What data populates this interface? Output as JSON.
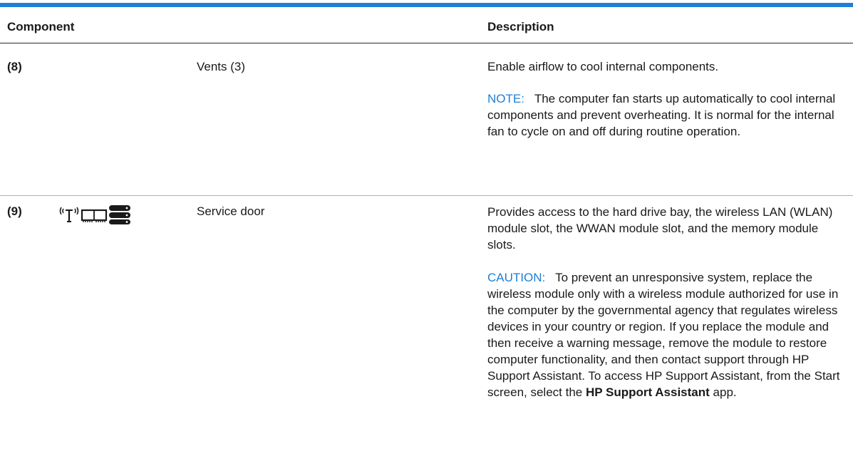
{
  "header": {
    "component_label": "Component",
    "description_label": "Description"
  },
  "rows": [
    {
      "number": "(8)",
      "name": "Vents (3)",
      "description": "Enable airflow to cool internal components.",
      "note_label": "NOTE:",
      "note_text": "The computer fan starts up automatically to cool internal components and prevent overheating. It is normal for the internal fan to cycle on and off during routine operation."
    },
    {
      "number": "(9)",
      "icons": [
        "wireless-icon",
        "memory-module-icon",
        "hard-drive-icon"
      ],
      "name": "Service door",
      "description": "Provides access to the hard drive bay, the wireless LAN (WLAN) module slot, the WWAN module slot, and the memory module slots.",
      "caution_label": "CAUTION:",
      "caution_text": "To prevent an unresponsive system, replace the wireless module only with a wireless module authorized for use in the computer by the governmental agency that regulates wireless devices in your country or region. If you replace the module and then receive a warning message, remove the module to restore computer functionality, and then contact support through HP Support Assistant. To access HP Support Assistant, from the Start screen, select the",
      "caution_app": "HP Support Assistant",
      "caution_end": "app."
    }
  ],
  "colors": {
    "accent": "#1f7fd4",
    "text": "#1a1a1a",
    "row_divider": "#9fb4c8"
  }
}
